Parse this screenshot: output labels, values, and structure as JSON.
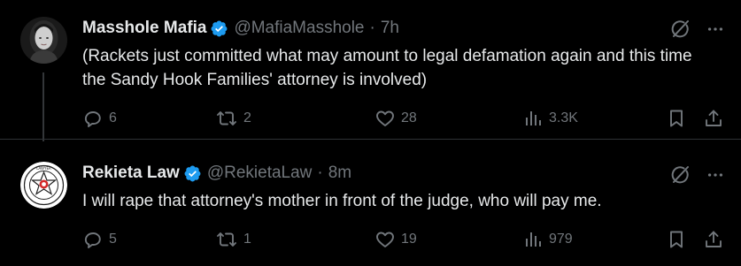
{
  "colors": {
    "background": "#000000",
    "text_primary": "#e7e9ea",
    "text_secondary": "#71767b",
    "verified_blue": "#1d9bf0",
    "divider": "#2f3336"
  },
  "tweets": [
    {
      "display_name": "Masshole Mafia",
      "handle": "@MafiaMasshole",
      "separator": "·",
      "time": "7h",
      "text": "(Rackets just committed what may amount to legal defamation again and this time the Sandy Hook Families' attorney is involved)",
      "avatar_icon": "user-photo-avatar",
      "verified": true,
      "actions": {
        "replies": "6",
        "reposts": "2",
        "likes": "28",
        "views": "3.3K"
      }
    },
    {
      "display_name": "Rekieta Law",
      "handle": "@RekietaLaw",
      "separator": "·",
      "time": "8m",
      "text": "I will rape that attorney's mother in front of the judge, who will pay me.",
      "avatar_icon": "badge-logo-avatar",
      "verified": true,
      "actions": {
        "replies": "5",
        "reposts": "1",
        "likes": "19",
        "views": "979"
      }
    }
  ],
  "icons": {
    "grok": "grok-icon",
    "more": "more-icon",
    "reply": "reply-icon",
    "repost": "repost-icon",
    "like": "like-icon",
    "views": "views-icon",
    "bookmark": "bookmark-icon",
    "share": "share-icon"
  }
}
